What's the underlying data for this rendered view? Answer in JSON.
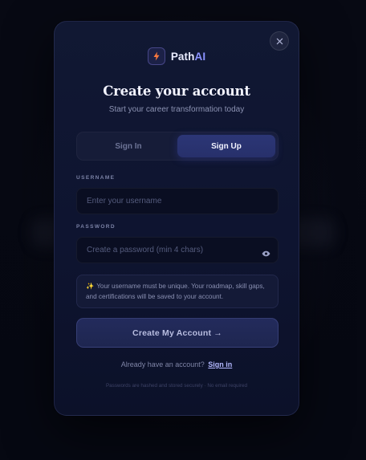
{
  "brand": {
    "name_main": "Path",
    "name_accent": "AI",
    "logo_icon": "lightning-bolt-icon",
    "accent_color": "#8b93ff",
    "bolt_color": "#ff7a3d"
  },
  "dialog": {
    "title": "Create your account",
    "subtitle": "Start your career transformation today",
    "close_icon": "close-icon"
  },
  "tabs": [
    {
      "label": "Sign In",
      "active": false
    },
    {
      "label": "Sign Up",
      "active": true
    }
  ],
  "form": {
    "username": {
      "label": "USERNAME",
      "placeholder": "Enter your username",
      "value": ""
    },
    "password": {
      "label": "PASSWORD",
      "placeholder": "Create a password (min 4 chars)",
      "value": "",
      "toggle_icon": "eye-icon"
    },
    "notice": {
      "icon": "sparkle-icon",
      "text": "Your username must be unique. Your roadmap, skill gaps, and certifications will be saved to your account."
    },
    "submit_label": "Create My Account →"
  },
  "switch": {
    "prompt": "Already have an account?",
    "link_label": "Sign in"
  },
  "footer_note": "Passwords are hashed and stored securely · No email required"
}
